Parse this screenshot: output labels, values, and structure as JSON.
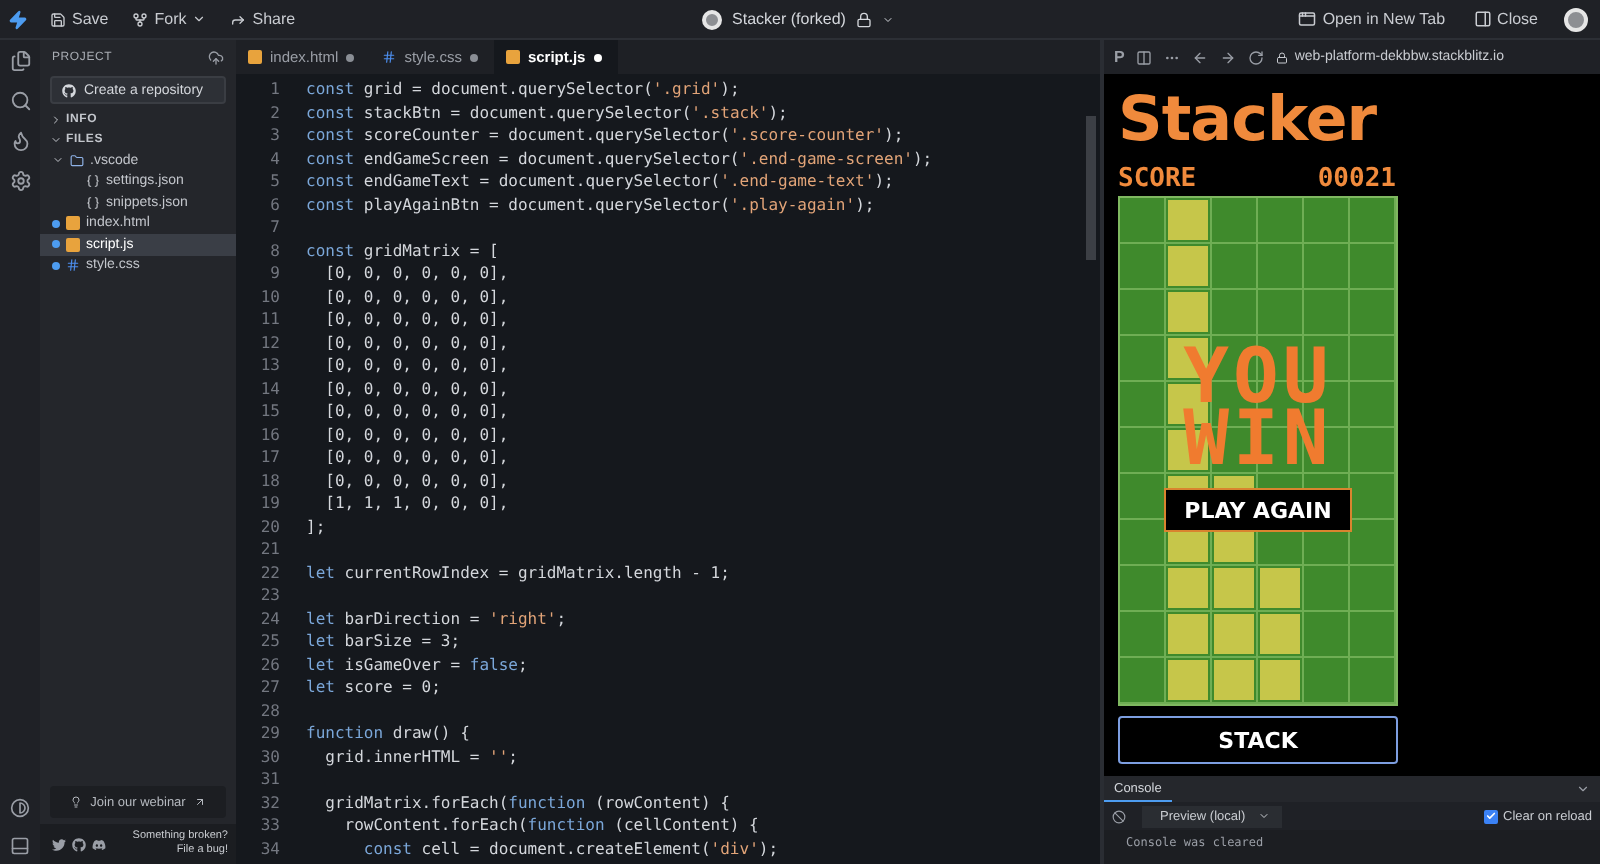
{
  "top_bar": {
    "actions": [
      {
        "kind": "save",
        "label": "Save",
        "dropdown": false
      },
      {
        "kind": "fork",
        "label": "Fork",
        "dropdown": true
      },
      {
        "kind": "share",
        "label": "Share",
        "dropdown": false
      }
    ],
    "project_title": "Stacker (forked)",
    "right_actions": [
      {
        "kind": "new-tab",
        "label": "Open in New Tab"
      },
      {
        "kind": "close",
        "label": "Close"
      }
    ]
  },
  "sidebar": {
    "title": "PROJECT",
    "repo_button": "Create a repository",
    "sections": [
      {
        "label": "INFO",
        "expanded": false
      },
      {
        "label": "FILES",
        "expanded": true,
        "children": [
          {
            "name": ".vscode",
            "kind": "folder",
            "expanded": true,
            "selected": false,
            "children": [
              {
                "name": "settings.json",
                "kind": "json",
                "selected": false,
                "modified": false
              },
              {
                "name": "snippets.json",
                "kind": "json",
                "selected": false,
                "modified": false
              }
            ]
          },
          {
            "name": "index.html",
            "kind": "html",
            "selected": false,
            "modified": true
          },
          {
            "name": "script.js",
            "kind": "js",
            "selected": true,
            "modified": true
          },
          {
            "name": "style.css",
            "kind": "css",
            "selected": false,
            "modified": true
          }
        ]
      }
    ],
    "webinar": "Join our webinar",
    "bug_report": [
      "Something broken?",
      "File a bug!"
    ]
  },
  "editor": {
    "tabs": [
      {
        "name": "index.html",
        "kind": "html",
        "selected": false,
        "modified": true
      },
      {
        "name": "style.css",
        "kind": "css",
        "selected": false,
        "modified": true
      },
      {
        "name": "script.js",
        "kind": "js",
        "selected": true,
        "modified": true
      }
    ],
    "lines": [
      {
        "number": "1",
        "segments": [
          {
            "kind": "keyword",
            "text": "const"
          },
          {
            "kind": "plain",
            "text": " grid = document.querySelector("
          },
          {
            "kind": "string",
            "text": "'.grid'"
          },
          {
            "kind": "plain",
            "text": ");"
          }
        ]
      },
      {
        "number": "2",
        "segments": [
          {
            "kind": "keyword",
            "text": "const"
          },
          {
            "kind": "plain",
            "text": " stackBtn = document.querySelector("
          },
          {
            "kind": "string",
            "text": "'.stack'"
          },
          {
            "kind": "plain",
            "text": ");"
          }
        ]
      },
      {
        "number": "3",
        "segments": [
          {
            "kind": "keyword",
            "text": "const"
          },
          {
            "kind": "plain",
            "text": " scoreCounter = document.querySelector("
          },
          {
            "kind": "string",
            "text": "'.score-counter'"
          },
          {
            "kind": "plain",
            "text": ");"
          }
        ]
      },
      {
        "number": "4",
        "segments": [
          {
            "kind": "keyword",
            "text": "const"
          },
          {
            "kind": "plain",
            "text": " endGameScreen = document.querySelector("
          },
          {
            "kind": "string",
            "text": "'.end-game-screen'"
          },
          {
            "kind": "plain",
            "text": ");"
          }
        ]
      },
      {
        "number": "5",
        "segments": [
          {
            "kind": "keyword",
            "text": "const"
          },
          {
            "kind": "plain",
            "text": " endGameText = document.querySelector("
          },
          {
            "kind": "string",
            "text": "'.end-game-text'"
          },
          {
            "kind": "plain",
            "text": ");"
          }
        ]
      },
      {
        "number": "6",
        "segments": [
          {
            "kind": "keyword",
            "text": "const"
          },
          {
            "kind": "plain",
            "text": " playAgainBtn = document.querySelector("
          },
          {
            "kind": "string",
            "text": "'.play-again'"
          },
          {
            "kind": "plain",
            "text": ");"
          }
        ]
      },
      {
        "number": "7"
      },
      {
        "number": "8",
        "segments": [
          {
            "kind": "keyword",
            "text": "const"
          },
          {
            "kind": "plain",
            "text": " gridMatrix = ["
          }
        ]
      },
      {
        "number": "9",
        "segments": [
          {
            "kind": "plain",
            "text": "  [0, 0, 0, 0, 0, 0],"
          }
        ]
      },
      {
        "number": "10",
        "segments": [
          {
            "kind": "plain",
            "text": "  [0, 0, 0, 0, 0, 0],"
          }
        ]
      },
      {
        "number": "11",
        "segments": [
          {
            "kind": "plain",
            "text": "  [0, 0, 0, 0, 0, 0],"
          }
        ]
      },
      {
        "number": "12",
        "segments": [
          {
            "kind": "plain",
            "text": "  [0, 0, 0, 0, 0, 0],"
          }
        ]
      },
      {
        "number": "13",
        "segments": [
          {
            "kind": "plain",
            "text": "  [0, 0, 0, 0, 0, 0],"
          }
        ]
      },
      {
        "number": "14",
        "segments": [
          {
            "kind": "plain",
            "text": "  [0, 0, 0, 0, 0, 0],"
          }
        ]
      },
      {
        "number": "15",
        "segments": [
          {
            "kind": "plain",
            "text": "  [0, 0, 0, 0, 0, 0],"
          }
        ]
      },
      {
        "number": "16",
        "segments": [
          {
            "kind": "plain",
            "text": "  [0, 0, 0, 0, 0, 0],"
          }
        ]
      },
      {
        "number": "17",
        "segments": [
          {
            "kind": "plain",
            "text": "  [0, 0, 0, 0, 0, 0],"
          }
        ]
      },
      {
        "number": "18",
        "segments": [
          {
            "kind": "plain",
            "text": "  [0, 0, 0, 0, 0, 0],"
          }
        ]
      },
      {
        "number": "19",
        "segments": [
          {
            "kind": "plain",
            "text": "  [1, 1, 1, 0, 0, 0],"
          }
        ]
      },
      {
        "number": "20",
        "segments": [
          {
            "kind": "plain",
            "text": "];"
          }
        ]
      },
      {
        "number": "21"
      },
      {
        "number": "22",
        "segments": [
          {
            "kind": "keyword",
            "text": "let"
          },
          {
            "kind": "plain",
            "text": " currentRowIndex = gridMatrix.length - 1;"
          }
        ]
      },
      {
        "number": "23"
      },
      {
        "number": "24",
        "segments": [
          {
            "kind": "keyword",
            "text": "let"
          },
          {
            "kind": "plain",
            "text": " barDirection = "
          },
          {
            "kind": "string",
            "text": "'right'"
          },
          {
            "kind": "plain",
            "text": ";"
          }
        ]
      },
      {
        "number": "25",
        "segments": [
          {
            "kind": "keyword",
            "text": "let"
          },
          {
            "kind": "plain",
            "text": " barSize = 3;"
          }
        ]
      },
      {
        "number": "26",
        "segments": [
          {
            "kind": "keyword",
            "text": "let"
          },
          {
            "kind": "plain",
            "text": " isGameOver = "
          },
          {
            "kind": "keyword",
            "text": "false"
          },
          {
            "kind": "plain",
            "text": ";"
          }
        ]
      },
      {
        "number": "27",
        "segments": [
          {
            "kind": "keyword",
            "text": "let"
          },
          {
            "kind": "plain",
            "text": " score = 0;"
          }
        ]
      },
      {
        "number": "28"
      },
      {
        "number": "29",
        "segments": [
          {
            "kind": "keyword",
            "text": "function"
          },
          {
            "kind": "plain",
            "text": " draw() {"
          }
        ]
      },
      {
        "number": "30",
        "segments": [
          {
            "kind": "plain",
            "text": "  grid.innerHTML = "
          },
          {
            "kind": "string",
            "text": "''"
          },
          {
            "kind": "plain",
            "text": ";"
          }
        ]
      },
      {
        "number": "31"
      },
      {
        "number": "32",
        "segments": [
          {
            "kind": "plain",
            "text": "  gridMatrix.forEach("
          },
          {
            "kind": "keyword",
            "text": "function"
          },
          {
            "kind": "plain",
            "text": " (rowContent) {"
          }
        ]
      },
      {
        "number": "33",
        "segments": [
          {
            "kind": "plain",
            "text": "    rowContent.forEach("
          },
          {
            "kind": "keyword",
            "text": "function"
          },
          {
            "kind": "plain",
            "text": " (cellContent) {"
          }
        ]
      },
      {
        "number": "34",
        "segments": [
          {
            "kind": "keyword",
            "text": "      const"
          },
          {
            "kind": "plain",
            "text": " cell = document.createElement("
          },
          {
            "kind": "string",
            "text": "'div'"
          },
          {
            "kind": "plain",
            "text": ");"
          }
        ]
      }
    ]
  },
  "preview": {
    "mode_label": "P",
    "url": "web-platform-dekbbw.stackblitz.io",
    "game": {
      "title": "Stacker",
      "score_label": "SCORE",
      "score": "00021",
      "grid": [
        [
          false,
          true,
          false,
          false,
          false,
          false
        ],
        [
          false,
          true,
          false,
          false,
          false,
          false
        ],
        [
          false,
          true,
          false,
          false,
          false,
          false
        ],
        [
          false,
          true,
          false,
          false,
          false,
          false
        ],
        [
          false,
          true,
          false,
          false,
          false,
          false
        ],
        [
          false,
          true,
          false,
          false,
          false,
          false
        ],
        [
          false,
          true,
          true,
          false,
          false,
          false
        ],
        [
          false,
          true,
          true,
          false,
          false,
          false
        ],
        [
          false,
          true,
          true,
          true,
          false,
          false
        ],
        [
          false,
          true,
          true,
          true,
          false,
          false
        ],
        [
          false,
          true,
          true,
          true,
          false,
          false
        ]
      ],
      "end_text": [
        "YOU",
        "WIN"
      ],
      "play_again": "PLAY AGAIN",
      "stack_button": "STACK"
    },
    "console": {
      "tab": "Console",
      "source": "Preview (local)",
      "clear_on_reload": {
        "label": "Clear on reload",
        "checked": true
      },
      "messages": [
        "Console was cleared"
      ]
    }
  }
}
